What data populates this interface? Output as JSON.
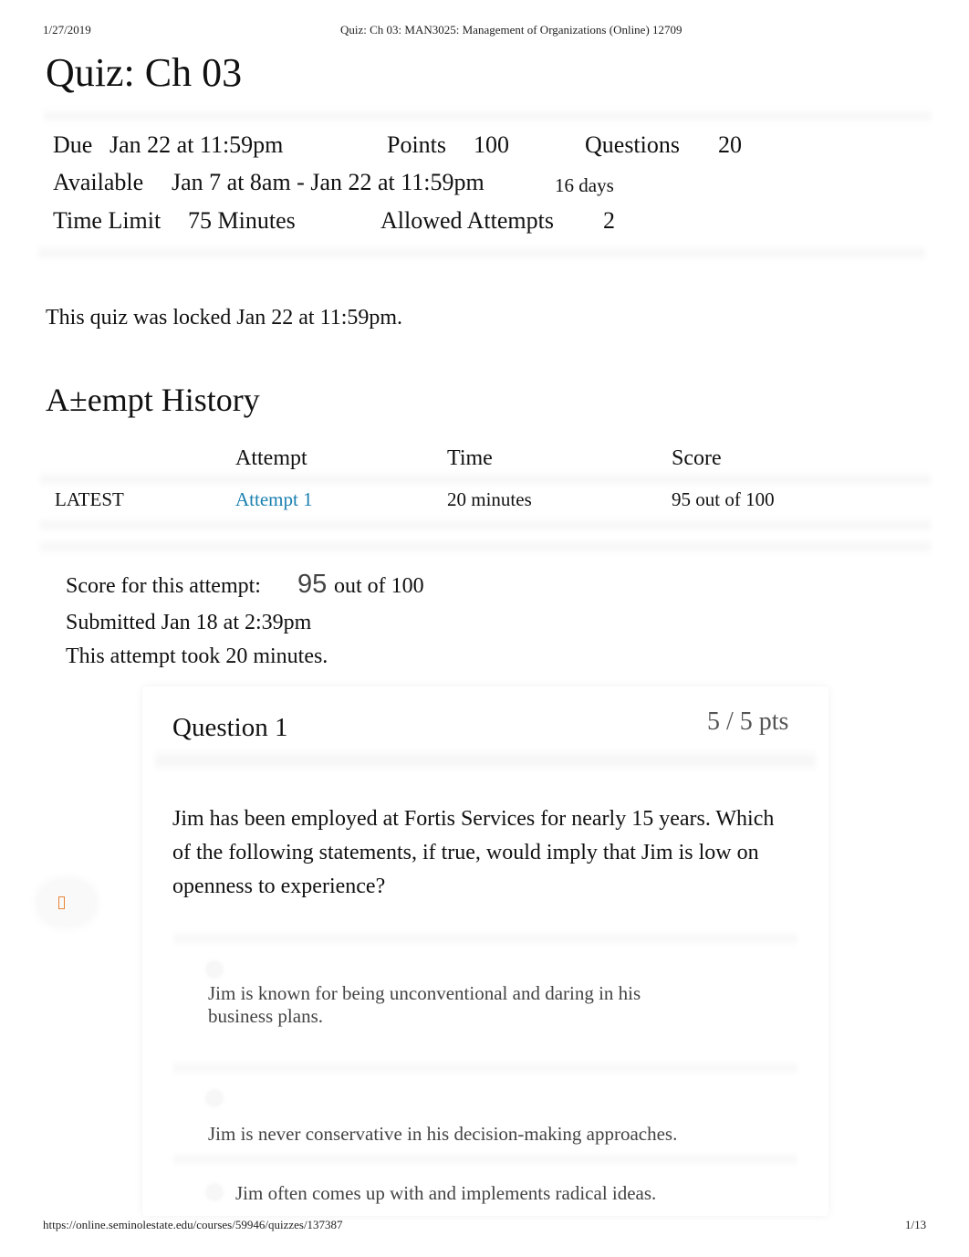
{
  "print_header": {
    "date": "1/27/2019",
    "title": "Quiz: Ch 03: MAN3025: Management of Organizations (Online) 12709"
  },
  "print_footer": {
    "url": "https://online.seminolestate.edu/courses/59946/quizzes/137387",
    "page": "1/13"
  },
  "quiz": {
    "title": "Quiz: Ch 03",
    "details": {
      "due_label": "Due",
      "due_value": "Jan 22 at 11:59pm",
      "points_label": "Points",
      "points_value": "100",
      "questions_label": "Questions",
      "questions_value": "20",
      "available_label": "Available",
      "available_value": "Jan 7 at 8am - Jan 22 at 11:59pm",
      "available_duration": "16 days",
      "time_limit_label": "Time Limit",
      "time_limit_value": "75 Minutes",
      "allowed_attempts_label": "Allowed Attempts",
      "allowed_attempts_value": "2"
    },
    "locked_message": "This quiz was locked Jan 22 at 11:59pm."
  },
  "attempt_history": {
    "title": "A±empt History",
    "columns": [
      "",
      "Attempt",
      "Time",
      "Score"
    ],
    "rows": [
      {
        "tag": "LATEST",
        "attempt": "Attempt 1",
        "time": "20 minutes",
        "score": "95 out of 100"
      }
    ]
  },
  "attempt_summary": {
    "score_label": "Score for this attempt:",
    "score_value": "95",
    "score_of": "out of 100",
    "submitted": "Submitted Jan 18 at 2:39pm",
    "duration": "This attempt took 20 minutes."
  },
  "question": {
    "title": "Question 1",
    "points": "5 / 5 pts",
    "text": "Jim has been employed at Fortis Services for nearly 15 years. Which of the following statements, if true, would imply that Jim is low on openness to experience?",
    "answers": [
      "Jim is known for being unconventional and daring in his business plans.",
      "Jim is never conservative in his decision-making approaches.",
      "Jim often comes up with and implements radical ideas."
    ]
  },
  "side_widget": {
    "icon": "flag-icon",
    "accent": "#e8843a"
  },
  "colors": {
    "link": "#1a7fb0",
    "text": "#111111",
    "muted": "#444444"
  }
}
